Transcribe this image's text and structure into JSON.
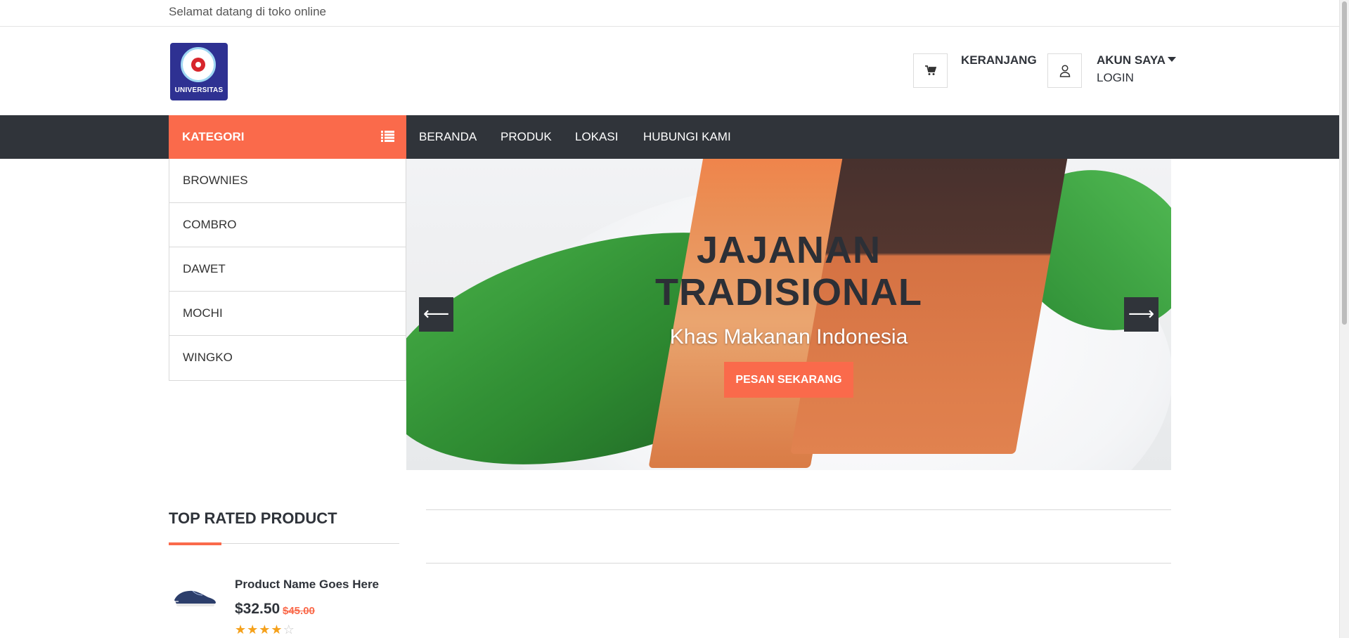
{
  "topbar": {
    "welcome": "Selamat datang di toko online"
  },
  "logo": {
    "name": "UNIVERSITAS",
    "icon": "university-logo"
  },
  "header": {
    "cart_label": "KERANJANG",
    "cart_icon": "cart-icon",
    "account_label": "AKUN SAYA",
    "account_icon": "user-icon",
    "login_label": "LOGIN"
  },
  "nav": {
    "category_title": "KATEGORI",
    "items": [
      "BERANDA",
      "PRODUK",
      "LOKASI",
      "HUBUNGI KAMI"
    ]
  },
  "categories": [
    "BROWNIES",
    "COMBRO",
    "DAWET",
    "MOCHI",
    "WINGKO"
  ],
  "hero": {
    "title_line1": "JAJANAN",
    "title_line2": "TRADISIONAL",
    "subtitle": "Khas Makanan Indonesia",
    "button": "PESAN SEKARANG",
    "prev": "⟵",
    "next": "⟶"
  },
  "top_rated": {
    "title": "TOP RATED PRODUCT",
    "product": {
      "name": "Product Name Goes Here",
      "price": "$32.50",
      "old_price": "$45.00",
      "rating": 4,
      "rating_max": 5
    }
  },
  "colors": {
    "accent": "#fa6a4b",
    "dark": "#30343a",
    "star": "#f5a11b"
  }
}
